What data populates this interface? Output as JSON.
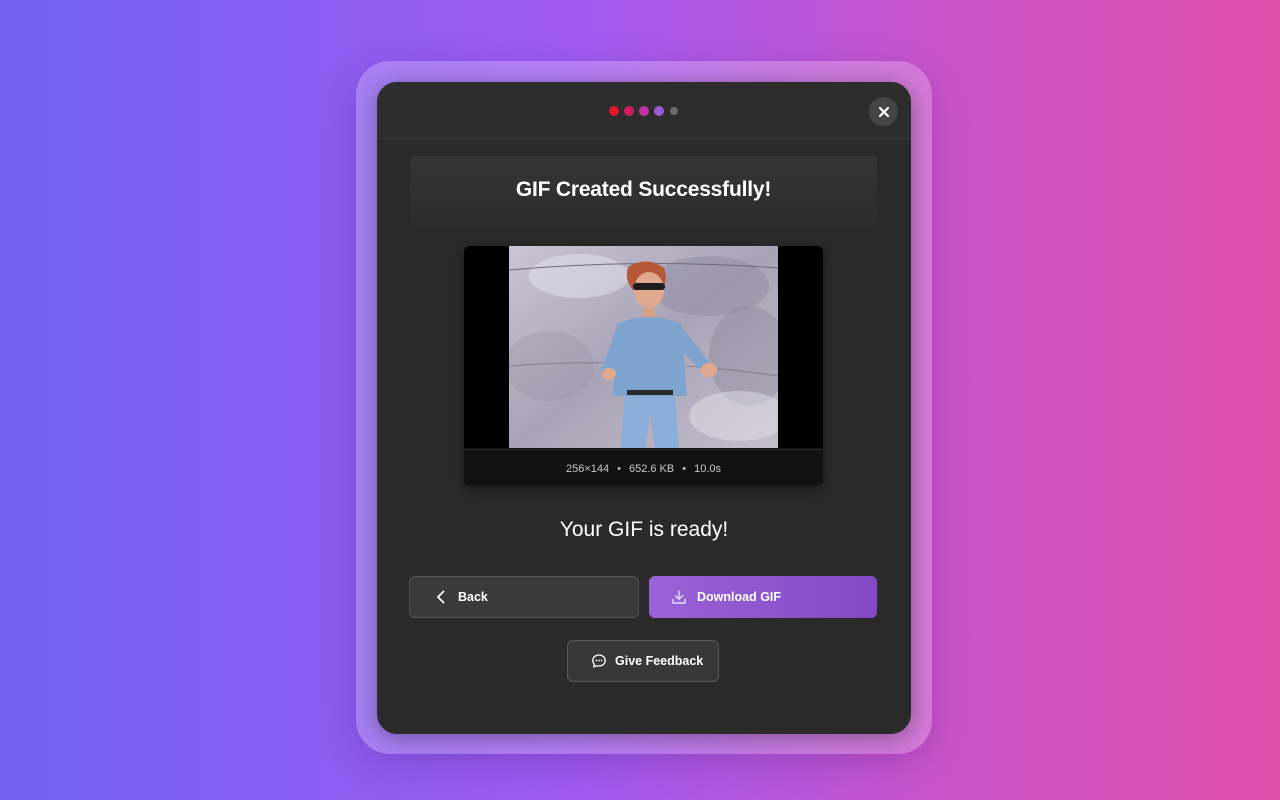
{
  "progress": {
    "current_step": 4,
    "total_steps": 5,
    "dot_colors": [
      "#e5162c",
      "#d81b5f",
      "#c234a3",
      "#9b59d9",
      "#6b6b6b"
    ]
  },
  "dialog": {
    "title": "GIF Created Successfully!",
    "close_icon": "close-icon",
    "status_message": "Your GIF is ready!"
  },
  "preview": {
    "dimensions": "256×144",
    "file_size": "652.6 KB",
    "duration": "10.0s",
    "separator": "•"
  },
  "actions": {
    "back_label": "Back",
    "back_icon": "chevron-left-icon",
    "download_label": "Download GIF",
    "download_icon": "download-icon",
    "feedback_label": "Give Feedback",
    "feedback_icon": "chat-bubble-icon"
  },
  "colors": {
    "accent": "#8f58d2",
    "dialog_bg": "#2a2a2a"
  }
}
